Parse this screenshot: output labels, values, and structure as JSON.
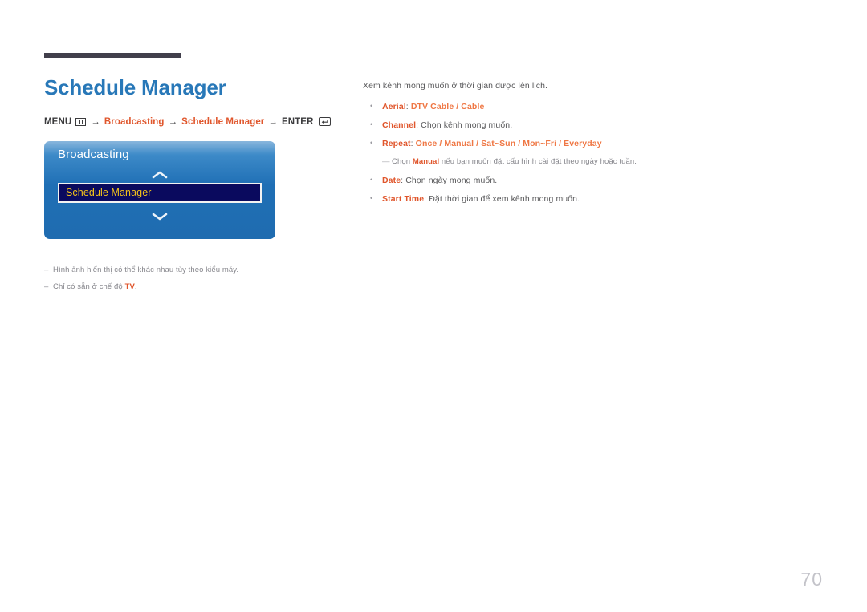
{
  "header": {
    "thick_rule": true,
    "thin_rule": true
  },
  "page": {
    "title": "Schedule Manager",
    "number": "70",
    "title_color": "#2878b8",
    "accent_color": "#e0562c"
  },
  "breadcrumb": {
    "menu_label": "MENU",
    "menu_icon": "menu-grid-icon",
    "arrow": "→",
    "step1": "Broadcasting",
    "step2": "Schedule Manager",
    "enter_label": "ENTER",
    "enter_icon": "enter-return-icon"
  },
  "osd": {
    "title": "Broadcasting",
    "up_icon": "chevron-up-icon",
    "down_icon": "chevron-down-icon",
    "selected_row": "Schedule Manager",
    "highlight_bg": "#0a0a5e",
    "highlight_text": "#f2c21a"
  },
  "footnotes": {
    "items": [
      {
        "dash": "–",
        "text": "Hình ảnh hiển thị có thể khác nhau tùy theo kiểu máy."
      },
      {
        "dash": "–",
        "prefix": "Chỉ có sẵn ở chế độ ",
        "accent": "TV",
        "suffix": "."
      }
    ]
  },
  "content": {
    "intro": "Xem kênh mong muốn ở thời gian được lên lịch.",
    "bullet_dot": "•",
    "items": [
      {
        "term": "Aerial",
        "colon": ": ",
        "options_text": "DTV Cable / Cable",
        "body": ""
      },
      {
        "term": "Channel",
        "colon": ": ",
        "options_text": "",
        "body": "Chọn kênh mong muốn."
      },
      {
        "term": "Repeat",
        "colon": ": ",
        "options_text": "Once / Manual / Sat~Sun / Mon~Fri / Everyday",
        "body": ""
      },
      {
        "term": "Date",
        "colon": ": ",
        "options_text": "",
        "body": "Chọn ngày mong muốn."
      },
      {
        "term": "Start Time",
        "colon": ": ",
        "options_text": "",
        "body": "Đặt thời gian để xem kênh mong muốn."
      }
    ],
    "subnote": {
      "dash": "—",
      "prefix": "Chọn ",
      "bold": "Manual",
      "suffix": " nếu bạn muốn đặt cấu hình cài đặt theo ngày hoặc tuần."
    }
  }
}
